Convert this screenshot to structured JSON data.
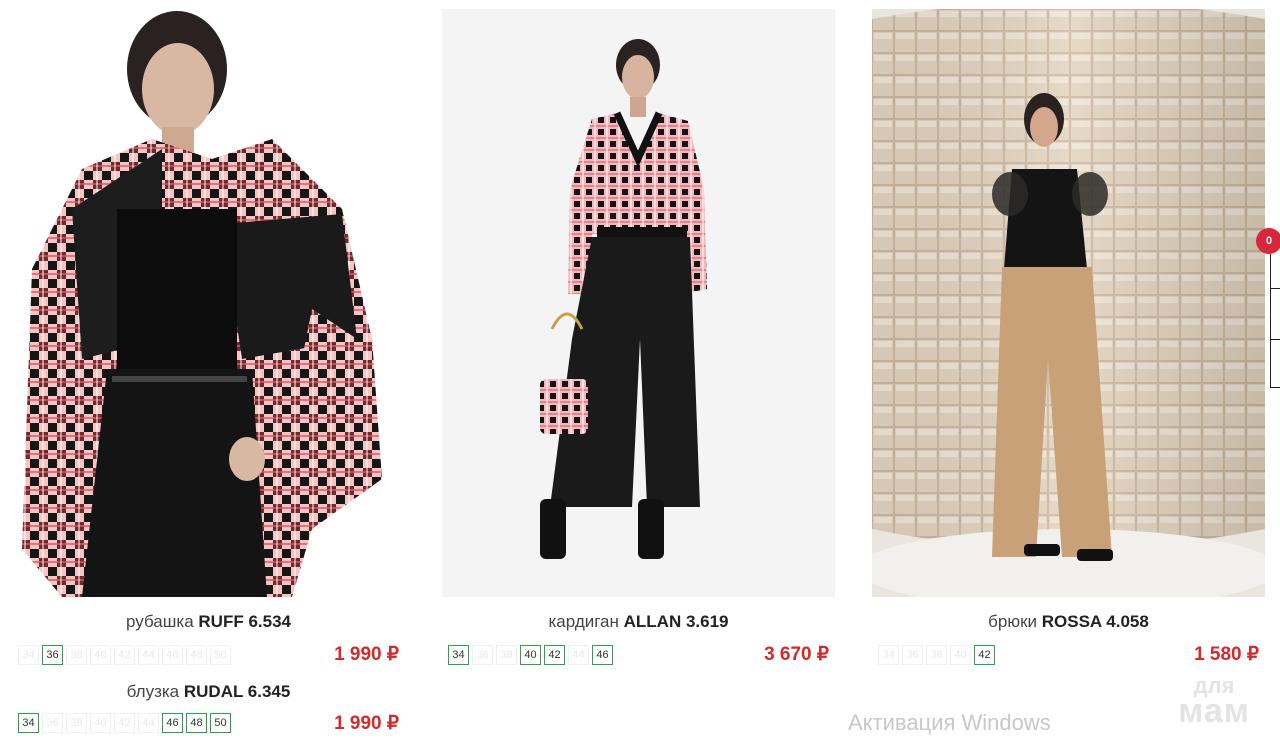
{
  "products": [
    {
      "category": "рубашка",
      "name": "RUFF 6.534",
      "price": "1 990 ₽",
      "sizes": [
        {
          "label": "34",
          "available": false
        },
        {
          "label": "36",
          "available": true
        },
        {
          "label": "38",
          "available": false
        },
        {
          "label": "40",
          "available": false
        },
        {
          "label": "42",
          "available": false
        },
        {
          "label": "44",
          "available": false
        },
        {
          "label": "46",
          "available": false
        },
        {
          "label": "48",
          "available": false
        },
        {
          "label": "50",
          "available": false
        }
      ]
    },
    {
      "category": "кардиган",
      "name": "ALLAN 3.619",
      "price": "3 670 ₽",
      "sizes": [
        {
          "label": "34",
          "available": true
        },
        {
          "label": "36",
          "available": false
        },
        {
          "label": "38",
          "available": false
        },
        {
          "label": "40",
          "available": true
        },
        {
          "label": "42",
          "available": true
        },
        {
          "label": "44",
          "available": false
        },
        {
          "label": "46",
          "available": true
        }
      ]
    },
    {
      "category": "брюки",
      "name": "ROSSA 4.058",
      "price": "1 580 ₽",
      "sizes": [
        {
          "label": "34",
          "available": false
        },
        {
          "label": "36",
          "available": false
        },
        {
          "label": "38",
          "available": false
        },
        {
          "label": "40",
          "available": false
        },
        {
          "label": "42",
          "available": true
        }
      ]
    },
    {
      "category": "блузка",
      "name": "RUDAL 6.345",
      "price": "1 990 ₽",
      "sizes": [
        {
          "label": "34",
          "available": true
        },
        {
          "label": "36",
          "available": false
        },
        {
          "label": "38",
          "available": false
        },
        {
          "label": "40",
          "available": false
        },
        {
          "label": "42",
          "available": false
        },
        {
          "label": "44",
          "available": false
        },
        {
          "label": "46",
          "available": true
        },
        {
          "label": "48",
          "available": true
        },
        {
          "label": "50",
          "available": true
        }
      ]
    }
  ],
  "cart": {
    "count": "0"
  },
  "overlay": {
    "windows_activation": "Активация Windows",
    "watermark_line1": "для",
    "watermark_line2": "мам"
  },
  "colors": {
    "price": "#d32a2a",
    "size_available_border": "#2aa24a",
    "badge": "#d8263a"
  }
}
